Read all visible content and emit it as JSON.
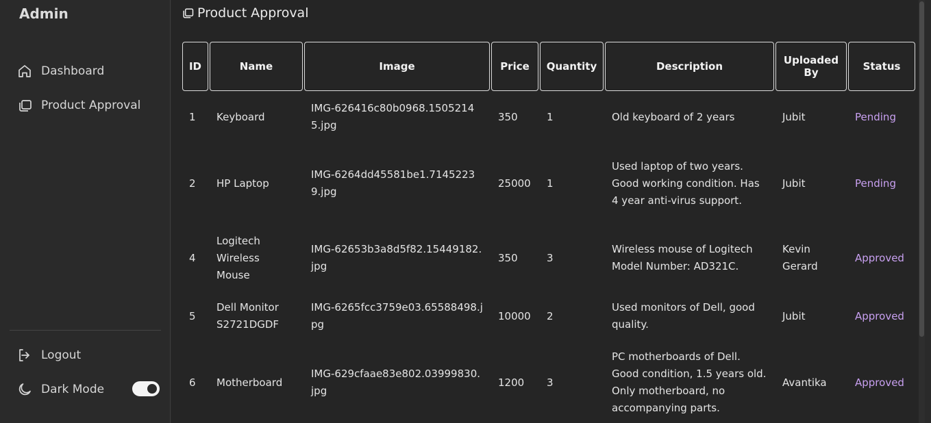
{
  "sidebar": {
    "brand": "Admin",
    "items": [
      {
        "label": "Dashboard",
        "icon": "home-icon"
      },
      {
        "label": "Product Approval",
        "icon": "copy-icon"
      }
    ],
    "logout_label": "Logout",
    "dark_mode_label": "Dark Mode",
    "dark_mode_on": true
  },
  "main": {
    "title": "Product Approval",
    "columns": [
      "ID",
      "Name",
      "Image",
      "Price",
      "Quantity",
      "Description",
      "Uploaded By",
      "Status"
    ],
    "rows": [
      {
        "id": "1",
        "name": "Keyboard",
        "image": "IMG-626416c80b0968.15052145.jpg",
        "price": "350",
        "quantity": "1",
        "description": "Old keyboard of 2 years",
        "uploaded_by": "Jubit",
        "status": "Pending"
      },
      {
        "id": "2",
        "name": "HP Laptop",
        "image": "IMG-6264dd45581be1.71452239.jpg",
        "price": "25000",
        "quantity": "1",
        "description": "Used laptop of two years. Good working condition. Has 4 year anti-virus support.",
        "uploaded_by": "Jubit",
        "status": "Pending"
      },
      {
        "id": "4",
        "name": "Logitech Wireless Mouse",
        "image": "IMG-62653b3a8d5f82.15449182.jpg",
        "price": "350",
        "quantity": "3",
        "description": "Wireless mouse of Logitech Model Number: AD321C.",
        "uploaded_by": "Kevin Gerard",
        "status": "Approved"
      },
      {
        "id": "5",
        "name": "Dell Monitor S2721DGDF",
        "image": "IMG-6265fcc3759e03.65588498.jpg",
        "price": "10000",
        "quantity": "2",
        "description": "Used monitors of Dell, good quality.",
        "uploaded_by": "Jubit",
        "status": "Approved"
      },
      {
        "id": "6",
        "name": "Motherboard",
        "image": "IMG-629cfaae83e802.03999830.jpg",
        "price": "1200",
        "quantity": "3",
        "description": "PC motherboards of Dell. Good condition, 1.5 years old. Only motherboard, no accompanying parts.",
        "uploaded_by": "Avantika",
        "status": "Approved"
      }
    ]
  },
  "colors": {
    "background": "#252525",
    "sidebar": "#2a2a2a",
    "status": "#c8a0f0"
  }
}
